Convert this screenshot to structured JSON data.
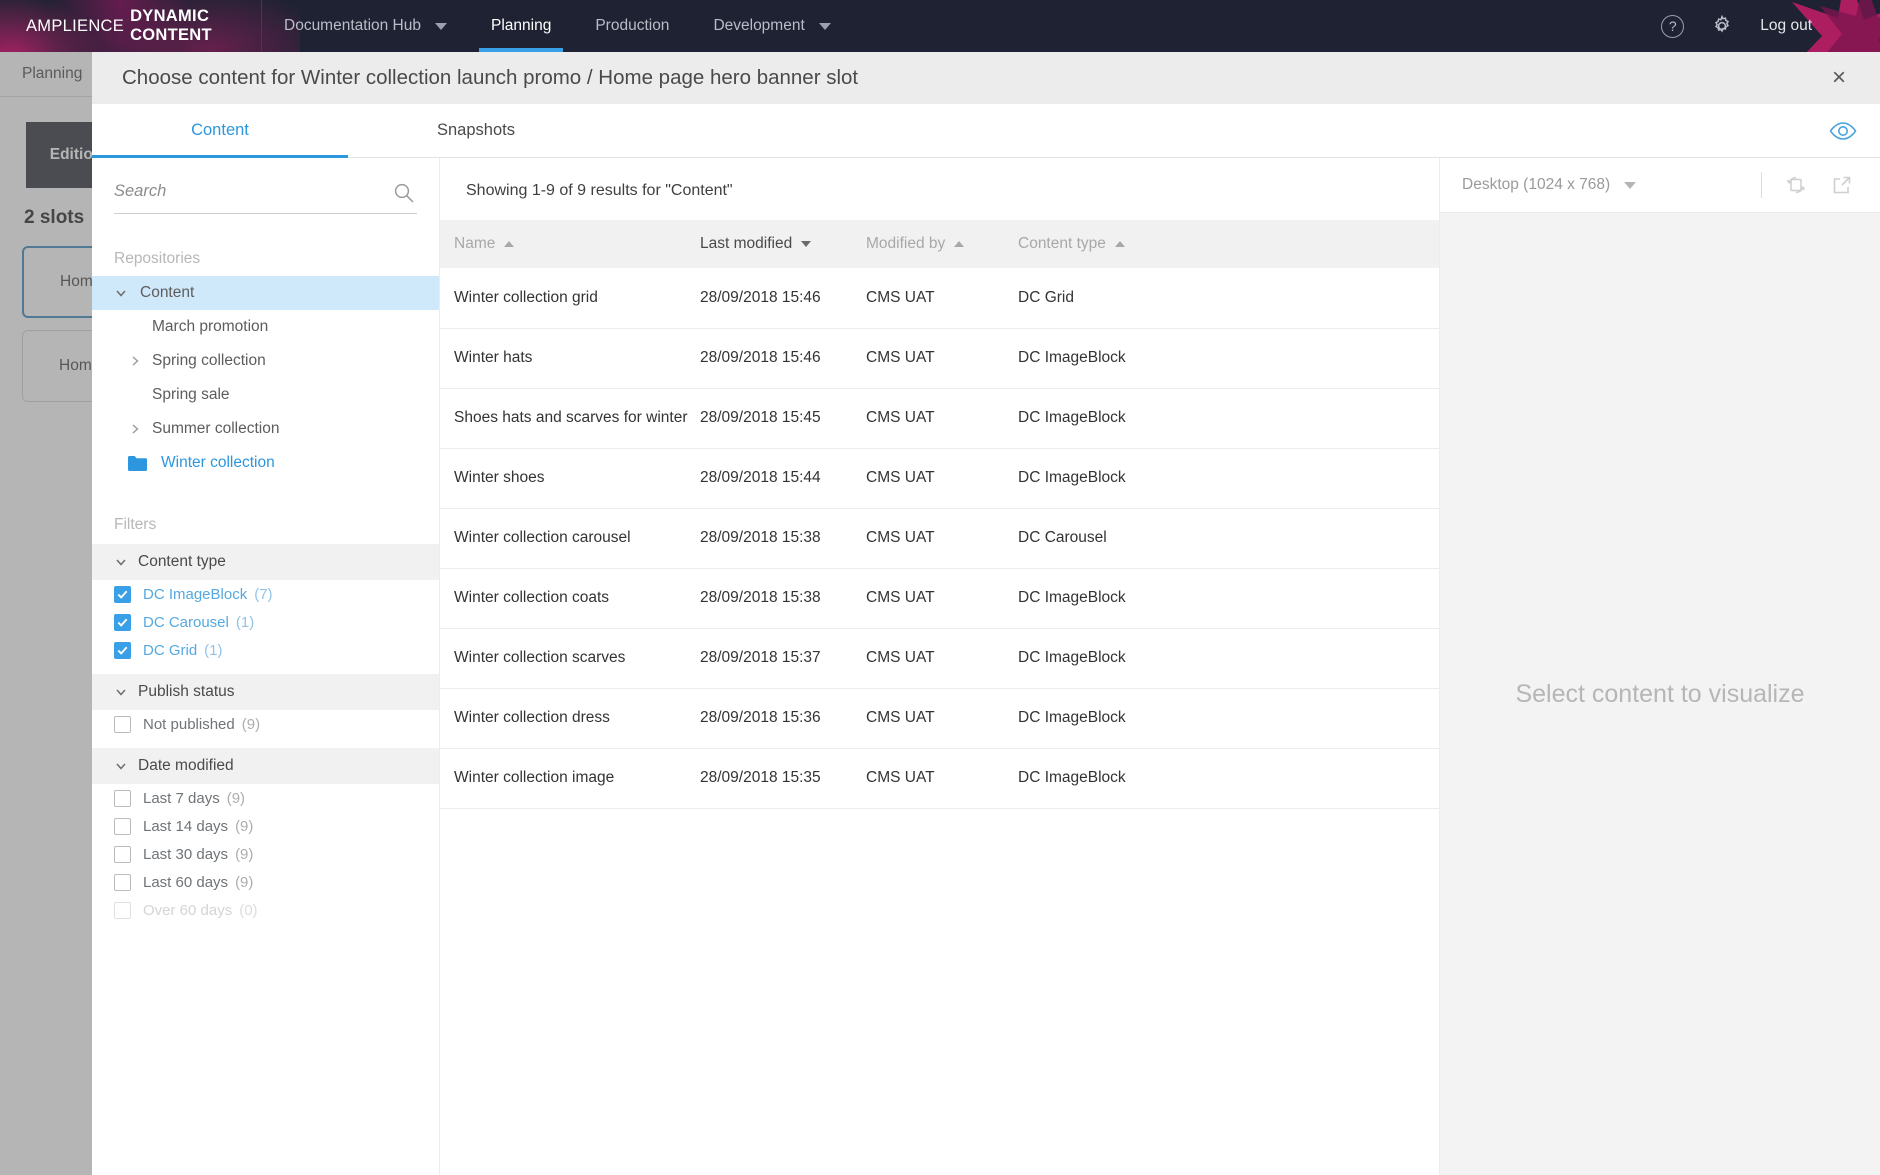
{
  "topnav": {
    "brand_light": "AMPLIENCE",
    "brand_bold": "DYNAMIC CONTENT",
    "hub_label": "Documentation Hub",
    "items": [
      {
        "label": "Planning",
        "active": true
      },
      {
        "label": "Production",
        "active": false
      },
      {
        "label": "Development",
        "active": false
      }
    ],
    "help_glyph": "?",
    "logout_label": "Log out"
  },
  "background": {
    "breadcrumb": "Planning",
    "edition_label": "Edition",
    "slots_heading": "2 slots",
    "cards": [
      "Home",
      "Home"
    ]
  },
  "modal": {
    "title": "Choose content for Winter collection launch promo / Home page hero banner slot",
    "close_glyph": "×",
    "tabs": [
      {
        "label": "Content",
        "active": true
      },
      {
        "label": "Snapshots",
        "active": false
      }
    ]
  },
  "left": {
    "search": {
      "placeholder": "Search",
      "value": ""
    },
    "repositories_label": "Repositories",
    "tree": [
      {
        "label": "Content",
        "type": "root",
        "expanded": true,
        "selected_bg": true
      },
      {
        "label": "March promotion",
        "type": "leaf"
      },
      {
        "label": "Spring collection",
        "type": "expandable"
      },
      {
        "label": "Spring sale",
        "type": "leaf"
      },
      {
        "label": "Summer collection",
        "type": "expandable"
      },
      {
        "label": "Winter collection",
        "type": "folder-selected"
      }
    ],
    "filters_label": "Filters",
    "filter_groups": [
      {
        "title": "Content type",
        "options": [
          {
            "label": "DC ImageBlock",
            "count": "(7)",
            "checked": true,
            "disabled": false
          },
          {
            "label": "DC Carousel",
            "count": "(1)",
            "checked": true,
            "disabled": false
          },
          {
            "label": "DC Grid",
            "count": "(1)",
            "checked": true,
            "disabled": false
          }
        ]
      },
      {
        "title": "Publish status",
        "options": [
          {
            "label": "Not published",
            "count": "(9)",
            "checked": false,
            "disabled": false
          }
        ]
      },
      {
        "title": "Date modified",
        "options": [
          {
            "label": "Last 7 days",
            "count": "(9)",
            "checked": false,
            "disabled": false
          },
          {
            "label": "Last 14 days",
            "count": "(9)",
            "checked": false,
            "disabled": false
          },
          {
            "label": "Last 30 days",
            "count": "(9)",
            "checked": false,
            "disabled": false
          },
          {
            "label": "Last 60 days",
            "count": "(9)",
            "checked": false,
            "disabled": false
          },
          {
            "label": "Over 60 days",
            "count": "(0)",
            "checked": false,
            "disabled": true
          }
        ]
      }
    ]
  },
  "results": {
    "showing": "Showing 1-9 of 9 results for \"Content\"",
    "columns": [
      {
        "label": "Name",
        "sort": "up",
        "active": false
      },
      {
        "label": "Last modified",
        "sort": "down",
        "active": true
      },
      {
        "label": "Modified by",
        "sort": "up",
        "active": false
      },
      {
        "label": "Content type",
        "sort": "up",
        "active": false
      }
    ],
    "rows": [
      {
        "name": "Winter collection grid",
        "modified": "28/09/2018 15:46",
        "by": "CMS UAT",
        "type": "DC Grid"
      },
      {
        "name": "Winter hats",
        "modified": "28/09/2018 15:46",
        "by": "CMS UAT",
        "type": "DC ImageBlock"
      },
      {
        "name": "Shoes hats and scarves for winter",
        "modified": "28/09/2018 15:45",
        "by": "CMS UAT",
        "type": "DC ImageBlock"
      },
      {
        "name": "Winter shoes",
        "modified": "28/09/2018 15:44",
        "by": "CMS UAT",
        "type": "DC ImageBlock"
      },
      {
        "name": "Winter collection carousel",
        "modified": "28/09/2018 15:38",
        "by": "CMS UAT",
        "type": "DC Carousel"
      },
      {
        "name": "Winter collection coats",
        "modified": "28/09/2018 15:38",
        "by": "CMS UAT",
        "type": "DC ImageBlock"
      },
      {
        "name": "Winter collection scarves",
        "modified": "28/09/2018 15:37",
        "by": "CMS UAT",
        "type": "DC ImageBlock"
      },
      {
        "name": "Winter collection dress",
        "modified": "28/09/2018 15:36",
        "by": "CMS UAT",
        "type": "DC ImageBlock"
      },
      {
        "name": "Winter collection image",
        "modified": "28/09/2018 15:35",
        "by": "CMS UAT",
        "type": "DC ImageBlock"
      }
    ]
  },
  "preview": {
    "device": "Desktop (1024 x 768)",
    "empty_message": "Select content to visualize"
  },
  "colors": {
    "accent_blue": "#2c97de",
    "topbar_bg": "#1e2232",
    "brand_magenta": "#d82175",
    "selected_row_bg": "#cfe8fa"
  }
}
